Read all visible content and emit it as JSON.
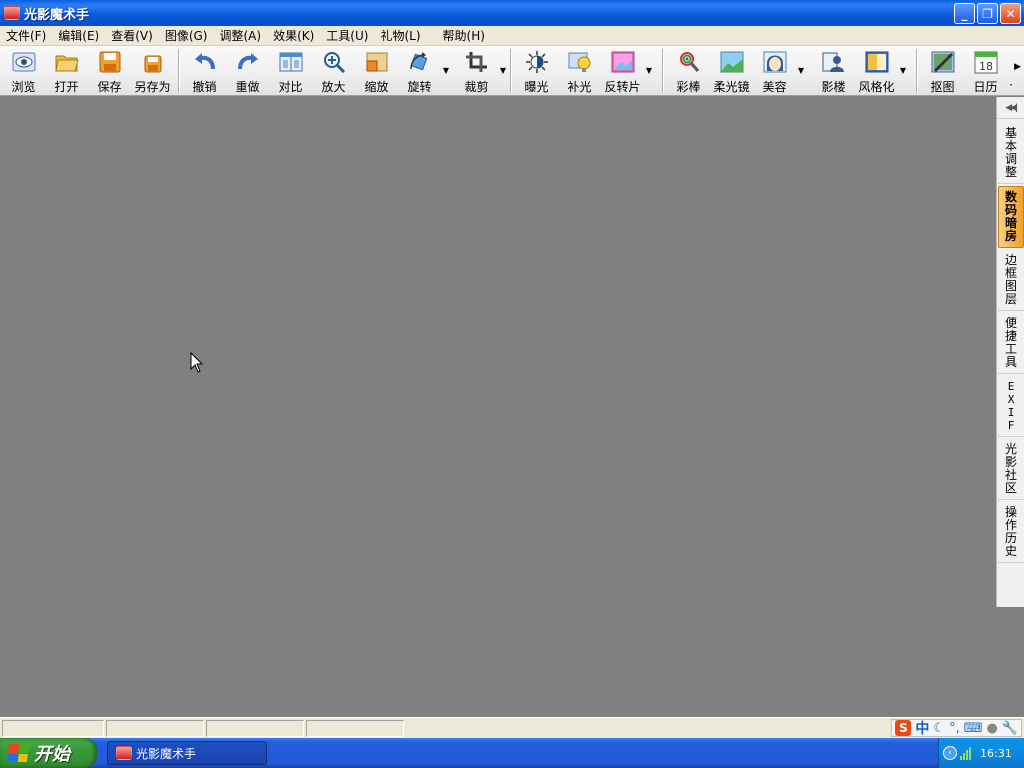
{
  "window": {
    "title": "光影魔术手",
    "minimize_glyph": "_",
    "restore_glyph": "❐",
    "close_glyph": "✕"
  },
  "menu": [
    {
      "label": "文件(F)"
    },
    {
      "label": "编辑(E)"
    },
    {
      "label": "查看(V)"
    },
    {
      "label": "图像(G)"
    },
    {
      "label": "调整(A)"
    },
    {
      "label": "效果(K)"
    },
    {
      "label": "工具(U)"
    },
    {
      "label": "礼物(L)"
    },
    {
      "label": "帮助(H)"
    }
  ],
  "toolbar": {
    "browse": {
      "label": "浏览",
      "icon": "eye-icon"
    },
    "open": {
      "label": "打开",
      "icon": "folder-open-icon"
    },
    "save": {
      "label": "保存",
      "icon": "floppy-icon"
    },
    "save_as": {
      "label": "另存为",
      "icon": "floppy-small-icon"
    },
    "undo": {
      "label": "撤销",
      "icon": "undo-icon"
    },
    "redo": {
      "label": "重做",
      "icon": "redo-icon"
    },
    "compare": {
      "label": "对比",
      "icon": "compare-icon"
    },
    "zoom_in": {
      "label": "放大",
      "icon": "magnifier-icon"
    },
    "resize": {
      "label": "缩放",
      "icon": "resize-icon"
    },
    "rotate": {
      "label": "旋转",
      "icon": "rotate-icon"
    },
    "crop": {
      "label": "裁剪",
      "icon": "crop-icon"
    },
    "exposure": {
      "label": "曝光",
      "icon": "sun-icon"
    },
    "fill_light": {
      "label": "补光",
      "icon": "bulb-icon"
    },
    "negative": {
      "label": "反转片",
      "icon": "picture-icon"
    },
    "color_wand": {
      "label": "彩棒",
      "icon": "wand-icon"
    },
    "soft_lens": {
      "label": "柔光镜",
      "icon": "landscape-icon"
    },
    "beauty": {
      "label": "美容",
      "icon": "face-icon"
    },
    "studio": {
      "label": "影楼",
      "icon": "person-icon"
    },
    "stylize": {
      "label": "风格化",
      "icon": "style-icon"
    },
    "cutout": {
      "label": "抠图",
      "icon": "cutout-icon"
    },
    "calendar": {
      "label": "日历",
      "icon": "calendar-icon",
      "day": "18"
    },
    "overflow": {
      "label": "·"
    }
  },
  "right_panel": {
    "tabs": [
      {
        "label": "基本调整",
        "chars": [
          "基",
          "本",
          "调",
          "整"
        ]
      },
      {
        "label": "数码暗房",
        "chars": [
          "数",
          "码",
          "暗",
          "房"
        ],
        "active": true
      },
      {
        "label": "边框图层",
        "chars": [
          "边",
          "框",
          "图",
          "层"
        ]
      },
      {
        "label": "便捷工具",
        "chars": [
          "便",
          "捷",
          "工",
          "具"
        ]
      },
      {
        "label": "EXIF",
        "chars": [
          "E",
          "X",
          "I",
          "F"
        ]
      },
      {
        "label": "光影社区",
        "chars": [
          "光",
          "影",
          "社",
          "区"
        ]
      },
      {
        "label": "操作历史",
        "chars": [
          "操",
          "作",
          "历",
          "史"
        ]
      }
    ]
  },
  "ime": {
    "logo": "S",
    "mode": "中"
  },
  "taskbar": {
    "start_label": "开始",
    "task_label": "光影魔术手",
    "clock": "16:31"
  },
  "colors": {
    "canvas": "#808080",
    "title_bar": "#0a5fe0",
    "taskbar": "#245edb",
    "start_button": "#3a9a3a",
    "active_tab": "#f0a030"
  }
}
